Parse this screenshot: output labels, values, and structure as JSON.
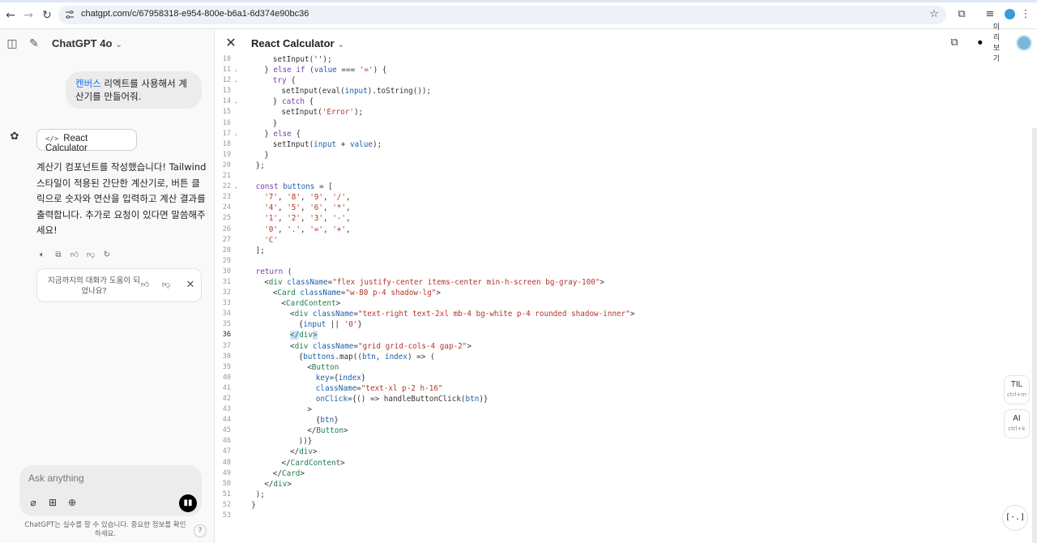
{
  "browser": {
    "url": "chatgpt.com/c/67958318-e954-800e-b6a1-6d374e90bc36"
  },
  "sidebar": {
    "model_name": "ChatGPT 4o",
    "user_message_highlight": "캔버스",
    "user_message_rest": " 리엑트를 사용해서 계산기를 만들어줘.",
    "canvas_button_label": "React Calculator",
    "assistant_reply": "계산기 컴포넌트를 작성했습니다! Tailwind 스타일이 적용된 간단한 계산기로, 버튼 클릭으로 숫자와 연산을 입력하고 계산 결과를 출력합니다. 추가로 요청이 있다면 말씀해주세요!",
    "feedback_prompt": "지금까지의 대화가 도움이 되었나요?",
    "composer_placeholder": "Ask anything",
    "disclaimer": "ChatGPT는 실수를 할 수 있습니다. 중요한 정보를 확인하세요.",
    "help_label": "?"
  },
  "canvas": {
    "title": "React Calculator",
    "vertical_label": "미리보기",
    "float_til": "TIL",
    "float_til_shortcut": "ctrl+m",
    "float_ai": "AI",
    "float_ai_shortcut": "ctrl+k",
    "fab_label": "[·.]",
    "current_line": 36,
    "code_lines": [
      {
        "n": "10",
        "fold": false,
        "indent": 4,
        "tokens": [
          [
            "plain",
            "setInput('');"
          ]
        ]
      },
      {
        "n": "11",
        "fold": true,
        "indent": 2,
        "tokens": [
          [
            "plain",
            "} "
          ],
          [
            "kw",
            "else if"
          ],
          [
            "plain",
            " ("
          ],
          [
            "attr",
            "value"
          ],
          [
            "plain",
            " === "
          ],
          [
            "str",
            "'='"
          ],
          [
            "plain",
            ") {"
          ]
        ]
      },
      {
        "n": "12",
        "fold": true,
        "indent": 4,
        "tokens": [
          [
            "kw",
            "try"
          ],
          [
            "plain",
            " {"
          ]
        ]
      },
      {
        "n": "13",
        "fold": false,
        "indent": 6,
        "tokens": [
          [
            "plain",
            "setInput(eval("
          ],
          [
            "attr",
            "input"
          ],
          [
            "plain",
            ").toString());"
          ]
        ]
      },
      {
        "n": "14",
        "fold": true,
        "indent": 4,
        "tokens": [
          [
            "plain",
            "} "
          ],
          [
            "kw",
            "catch"
          ],
          [
            "plain",
            " {"
          ]
        ]
      },
      {
        "n": "15",
        "fold": false,
        "indent": 6,
        "tokens": [
          [
            "plain",
            "setInput("
          ],
          [
            "str",
            "'Error'"
          ],
          [
            "plain",
            ");"
          ]
        ]
      },
      {
        "n": "16",
        "fold": false,
        "indent": 4,
        "tokens": [
          [
            "plain",
            "}"
          ]
        ]
      },
      {
        "n": "17",
        "fold": true,
        "indent": 2,
        "tokens": [
          [
            "plain",
            "} "
          ],
          [
            "kw",
            "else"
          ],
          [
            "plain",
            " {"
          ]
        ]
      },
      {
        "n": "18",
        "fold": false,
        "indent": 4,
        "tokens": [
          [
            "plain",
            "setInput("
          ],
          [
            "attr",
            "input"
          ],
          [
            "plain",
            " + "
          ],
          [
            "attr",
            "value"
          ],
          [
            "plain",
            ");"
          ]
        ]
      },
      {
        "n": "19",
        "fold": false,
        "indent": 2,
        "tokens": [
          [
            "plain",
            "}"
          ]
        ]
      },
      {
        "n": "20",
        "fold": false,
        "indent": 0,
        "tokens": [
          [
            "plain",
            "};"
          ]
        ]
      },
      {
        "n": "21",
        "fold": false,
        "indent": 0,
        "tokens": []
      },
      {
        "n": "22",
        "fold": true,
        "indent": 0,
        "tokens": [
          [
            "kw",
            "const"
          ],
          [
            "plain",
            " "
          ],
          [
            "attr",
            "buttons"
          ],
          [
            "plain",
            " = ["
          ]
        ]
      },
      {
        "n": "23",
        "fold": false,
        "indent": 2,
        "tokens": [
          [
            "str",
            "'7'"
          ],
          [
            "plain",
            ", "
          ],
          [
            "str",
            "'8'"
          ],
          [
            "plain",
            ", "
          ],
          [
            "str",
            "'9'"
          ],
          [
            "plain",
            ", "
          ],
          [
            "str",
            "'/'"
          ],
          [
            "plain",
            ","
          ]
        ]
      },
      {
        "n": "24",
        "fold": false,
        "indent": 2,
        "tokens": [
          [
            "str",
            "'4'"
          ],
          [
            "plain",
            ", "
          ],
          [
            "str",
            "'5'"
          ],
          [
            "plain",
            ", "
          ],
          [
            "str",
            "'6'"
          ],
          [
            "plain",
            ", "
          ],
          [
            "str",
            "'*'"
          ],
          [
            "plain",
            ","
          ]
        ]
      },
      {
        "n": "25",
        "fold": false,
        "indent": 2,
        "tokens": [
          [
            "str",
            "'1'"
          ],
          [
            "plain",
            ", "
          ],
          [
            "str",
            "'2'"
          ],
          [
            "plain",
            ", "
          ],
          [
            "str",
            "'3'"
          ],
          [
            "plain",
            ", "
          ],
          [
            "str",
            "'-'"
          ],
          [
            "plain",
            ","
          ]
        ]
      },
      {
        "n": "26",
        "fold": false,
        "indent": 2,
        "tokens": [
          [
            "str",
            "'0'"
          ],
          [
            "plain",
            ", "
          ],
          [
            "str",
            "'.'"
          ],
          [
            "plain",
            ", "
          ],
          [
            "str",
            "'='"
          ],
          [
            "plain",
            ", "
          ],
          [
            "str",
            "'+'"
          ],
          [
            "plain",
            ","
          ]
        ]
      },
      {
        "n": "27",
        "fold": false,
        "indent": 2,
        "tokens": [
          [
            "str",
            "'C'"
          ]
        ]
      },
      {
        "n": "28",
        "fold": false,
        "indent": 0,
        "tokens": [
          [
            "plain",
            "];"
          ]
        ]
      },
      {
        "n": "29",
        "fold": false,
        "indent": 0,
        "tokens": []
      },
      {
        "n": "30",
        "fold": false,
        "indent": 0,
        "tokens": [
          [
            "kw",
            "return"
          ],
          [
            "plain",
            " ("
          ]
        ]
      },
      {
        "n": "31",
        "fold": false,
        "indent": 2,
        "tokens": [
          [
            "plain",
            "<"
          ],
          [
            "tag",
            "div"
          ],
          [
            "plain",
            " "
          ],
          [
            "attr",
            "className"
          ],
          [
            "plain",
            "="
          ],
          [
            "str",
            "\"flex justify-center items-center min-h-screen bg-gray-100\""
          ],
          [
            "plain",
            ">"
          ]
        ]
      },
      {
        "n": "32",
        "fold": false,
        "indent": 4,
        "tokens": [
          [
            "plain",
            "<"
          ],
          [
            "tag",
            "Card"
          ],
          [
            "plain",
            " "
          ],
          [
            "attr",
            "className"
          ],
          [
            "plain",
            "="
          ],
          [
            "str",
            "\"w-80 p-4 shadow-lg\""
          ],
          [
            "plain",
            ">"
          ]
        ]
      },
      {
        "n": "33",
        "fold": false,
        "indent": 6,
        "tokens": [
          [
            "plain",
            "<"
          ],
          [
            "tag",
            "CardContent"
          ],
          [
            "plain",
            ">"
          ]
        ]
      },
      {
        "n": "34",
        "fold": false,
        "indent": 8,
        "tokens": [
          [
            "plain",
            "<"
          ],
          [
            "tag",
            "div"
          ],
          [
            "plain",
            " "
          ],
          [
            "attr",
            "className"
          ],
          [
            "plain",
            "="
          ],
          [
            "str",
            "\"text-right text-2xl mb-4 bg-white p-4 rounded shadow-inner\""
          ],
          [
            "plain",
            ">"
          ]
        ]
      },
      {
        "n": "35",
        "fold": false,
        "indent": 10,
        "tokens": [
          [
            "plain",
            "{"
          ],
          [
            "attr",
            "input"
          ],
          [
            "plain",
            " || "
          ],
          [
            "str",
            "'0'"
          ],
          [
            "plain",
            "}"
          ]
        ]
      },
      {
        "n": "36",
        "fold": false,
        "indent": 8,
        "tokens": [
          [
            "sel",
            "</"
          ],
          [
            "tag",
            "div"
          ],
          [
            "sel",
            ">"
          ]
        ]
      },
      {
        "n": "37",
        "fold": false,
        "indent": 8,
        "tokens": [
          [
            "plain",
            "<"
          ],
          [
            "tag",
            "div"
          ],
          [
            "plain",
            " "
          ],
          [
            "attr",
            "className"
          ],
          [
            "plain",
            "="
          ],
          [
            "str",
            "\"grid grid-cols-4 gap-2\""
          ],
          [
            "plain",
            ">"
          ]
        ]
      },
      {
        "n": "38",
        "fold": false,
        "indent": 10,
        "tokens": [
          [
            "plain",
            "{"
          ],
          [
            "attr",
            "buttons"
          ],
          [
            "plain",
            ".map(("
          ],
          [
            "attr",
            "btn"
          ],
          [
            "plain",
            ", "
          ],
          [
            "attr",
            "index"
          ],
          [
            "plain",
            ") => ("
          ]
        ]
      },
      {
        "n": "39",
        "fold": false,
        "indent": 12,
        "tokens": [
          [
            "plain",
            "<"
          ],
          [
            "tag",
            "Button"
          ]
        ]
      },
      {
        "n": "40",
        "fold": false,
        "indent": 14,
        "tokens": [
          [
            "attr",
            "key"
          ],
          [
            "plain",
            "={"
          ],
          [
            "attr",
            "index"
          ],
          [
            "plain",
            "}"
          ]
        ]
      },
      {
        "n": "41",
        "fold": false,
        "indent": 14,
        "tokens": [
          [
            "attr",
            "className"
          ],
          [
            "plain",
            "="
          ],
          [
            "str",
            "\"text-xl p-2 h-16\""
          ]
        ]
      },
      {
        "n": "42",
        "fold": false,
        "indent": 14,
        "tokens": [
          [
            "attr",
            "onClick"
          ],
          [
            "plain",
            "={() => handleButtonClick("
          ],
          [
            "attr",
            "btn"
          ],
          [
            "plain",
            ")}"
          ]
        ]
      },
      {
        "n": "43",
        "fold": false,
        "indent": 12,
        "tokens": [
          [
            "plain",
            ">"
          ]
        ]
      },
      {
        "n": "44",
        "fold": false,
        "indent": 14,
        "tokens": [
          [
            "plain",
            "{"
          ],
          [
            "attr",
            "btn"
          ],
          [
            "plain",
            "}"
          ]
        ]
      },
      {
        "n": "45",
        "fold": false,
        "indent": 12,
        "tokens": [
          [
            "plain",
            "</"
          ],
          [
            "tag",
            "Button"
          ],
          [
            "plain",
            ">"
          ]
        ]
      },
      {
        "n": "46",
        "fold": false,
        "indent": 10,
        "tokens": [
          [
            "plain",
            "))}"
          ]
        ]
      },
      {
        "n": "47",
        "fold": false,
        "indent": 8,
        "tokens": [
          [
            "plain",
            "</"
          ],
          [
            "tag",
            "div"
          ],
          [
            "plain",
            ">"
          ]
        ]
      },
      {
        "n": "48",
        "fold": false,
        "indent": 6,
        "tokens": [
          [
            "plain",
            "</"
          ],
          [
            "tag",
            "CardContent"
          ],
          [
            "plain",
            ">"
          ]
        ]
      },
      {
        "n": "49",
        "fold": false,
        "indent": 4,
        "tokens": [
          [
            "plain",
            "</"
          ],
          [
            "tag",
            "Card"
          ],
          [
            "plain",
            ">"
          ]
        ]
      },
      {
        "n": "50",
        "fold": false,
        "indent": 2,
        "tokens": [
          [
            "plain",
            "</"
          ],
          [
            "tag",
            "div"
          ],
          [
            "plain",
            ">"
          ]
        ]
      },
      {
        "n": "51",
        "fold": false,
        "indent": 0,
        "tokens": [
          [
            "plain",
            ");"
          ]
        ]
      },
      {
        "n": "52",
        "fold": false,
        "indent": -1,
        "tokens": [
          [
            "plain",
            "}"
          ]
        ]
      },
      {
        "n": "53",
        "fold": false,
        "indent": 0,
        "tokens": []
      }
    ]
  }
}
